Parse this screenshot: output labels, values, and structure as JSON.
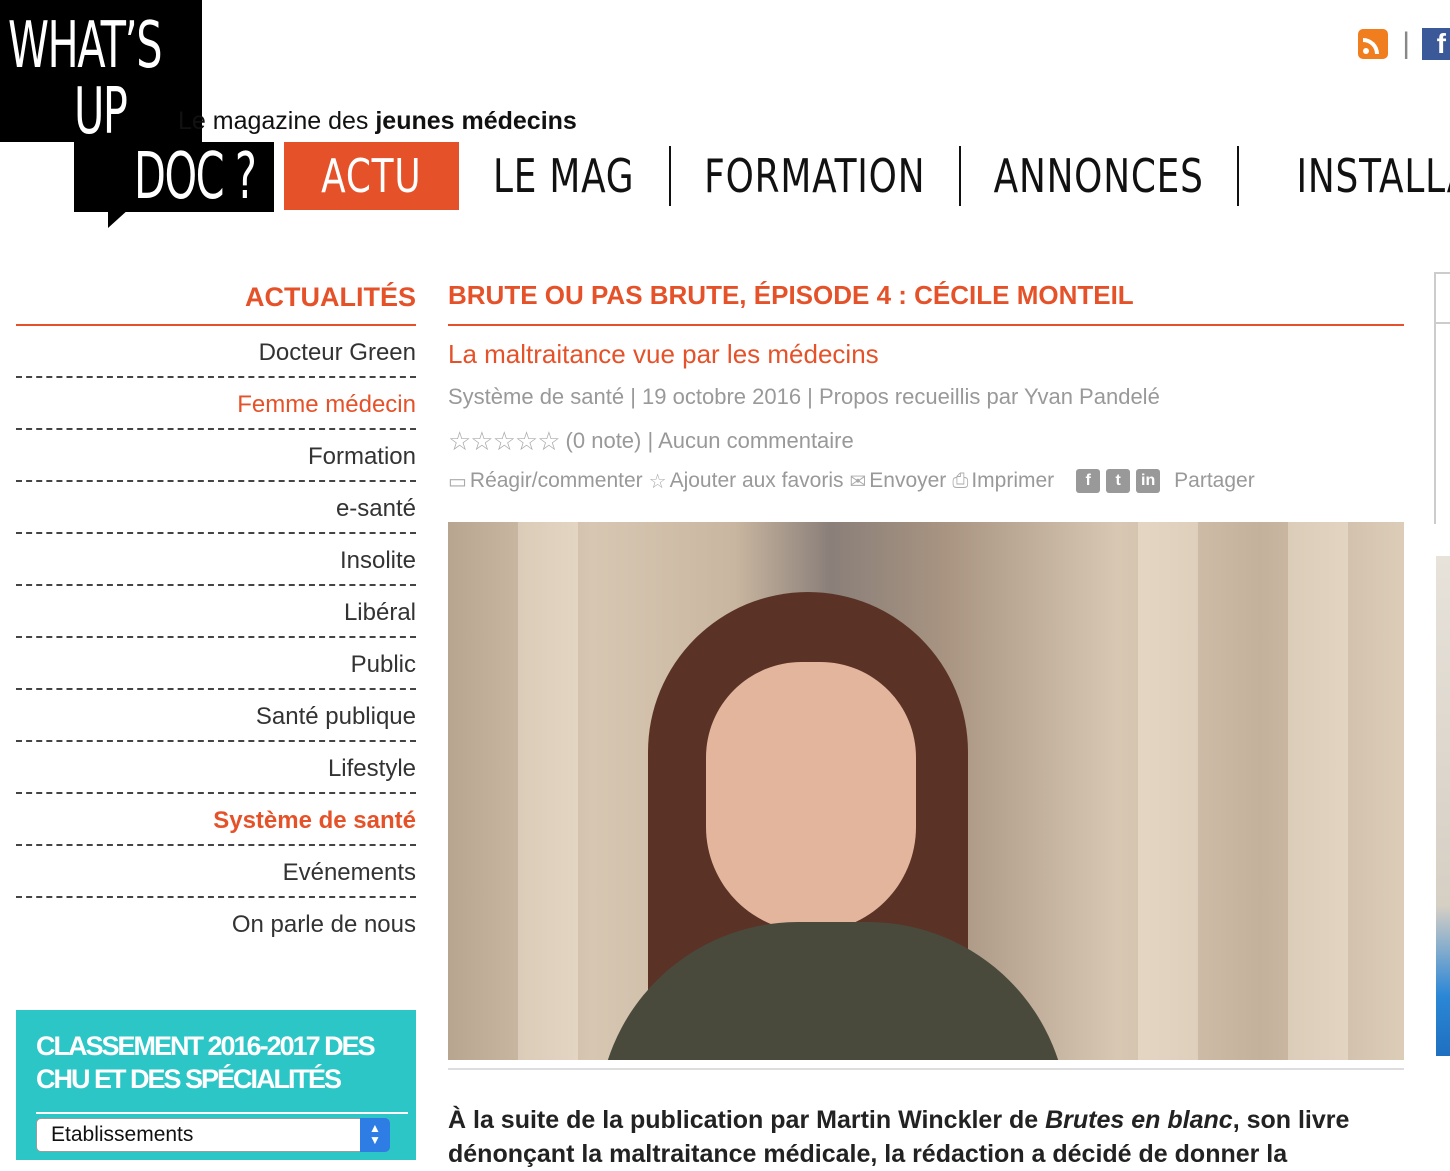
{
  "logo": {
    "line1": "WHAT’S",
    "line2": "UP",
    "line3": "DOC ?"
  },
  "tagline": {
    "prefix": "Le magazine des ",
    "bold": "jeunes médecins"
  },
  "nav": {
    "items": [
      "ACTU",
      "LE MAG",
      "FORMATION",
      "ANNONCES",
      "INSTALLAT"
    ]
  },
  "header_icons": {
    "separator": "|",
    "facebook_letter": "f"
  },
  "sidebar": {
    "title": "ACTUALITÉS",
    "items": [
      "Docteur Green",
      "Femme médecin",
      "Formation",
      "e-santé",
      "Insolite",
      "Libéral",
      "Public",
      "Santé publique",
      "Lifestyle",
      "Système de santé",
      "Evénements",
      "On parle de nous"
    ]
  },
  "ranking": {
    "title": "CLASSEMENT 2016-2017 DES CHU ET DES SPÉCIALITÉS",
    "select_value": "Etablissements"
  },
  "article": {
    "kicker": "BRUTE OU PAS BRUTE, ÉPISODE 4 : CÉCILE MONTEIL",
    "subtitle": "La maltraitance vue par les médecins",
    "meta": "Système de santé | 19 octobre 2016 | Propos recueillis par Yvan Pandelé",
    "stars": "☆☆☆☆☆",
    "rating": "(0 note) | Aucun commentaire",
    "actions": {
      "comment": "Réagir/commenter",
      "favorite": "Ajouter aux favoris",
      "send": "Envoyer",
      "print": "Imprimer",
      "share": "Partager"
    },
    "share_icons": {
      "facebook": "f",
      "twitter": "t",
      "linkedin": "in"
    },
    "lead": {
      "part1": "À la suite de la publication par Martin Winckler de ",
      "italic": "Brutes en blanc",
      "part2": ", son livre dénonçant la maltraitance médicale, la rédaction a décidé de donner la"
    }
  },
  "colors": {
    "accent": "#e5522a",
    "ranking_bg": "#2dc6c7",
    "facebook": "#3b5998",
    "rss": "#f07d1e"
  }
}
